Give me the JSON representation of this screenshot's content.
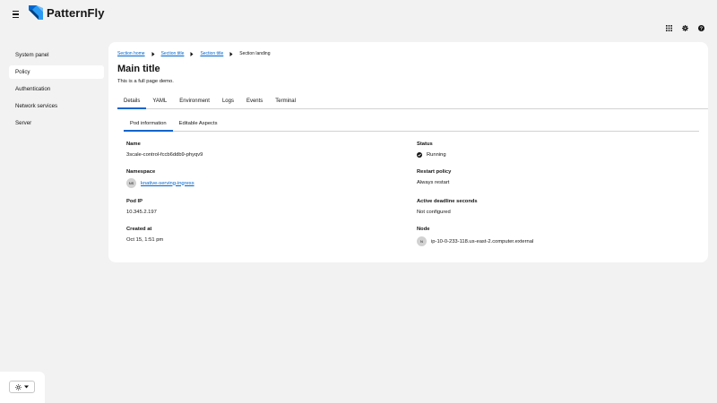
{
  "masthead": {
    "brand": "PatternFly",
    "icons": [
      "grid-icon",
      "gear-icon",
      "help-icon"
    ]
  },
  "sidebar": {
    "items": [
      {
        "label": "System panel"
      },
      {
        "label": "Policy"
      },
      {
        "label": "Authentication"
      },
      {
        "label": "Network services"
      },
      {
        "label": "Server"
      }
    ],
    "active": "Policy"
  },
  "breadcrumb": {
    "items": [
      "Section home",
      "Section title",
      "Section title"
    ],
    "current": "Section landing"
  },
  "page": {
    "title": "Main title",
    "subtitle": "This is a full page demo."
  },
  "tabs": [
    "Details",
    "YAML",
    "Environment",
    "Logs",
    "Events",
    "Terminal"
  ],
  "subtabs": [
    "Pod information",
    "Editable Aspects"
  ],
  "details": {
    "name_label": "Name",
    "name_value": "3scale-control-fccb6ddb9-phyqv9",
    "namespace_label": "Namespace",
    "namespace_badge": "NS",
    "namespace_value": "knative-serving-ingress",
    "pod_ip_label": "Pod IP",
    "pod_ip_value": "10.345.2.197",
    "created_label": "Created at",
    "created_value": "Oct 15, 1:51 pm",
    "status_label": "Status",
    "status_value": "Running",
    "restart_label": "Restart policy",
    "restart_value": "Always restart",
    "deadline_label": "Active deadline seconds",
    "deadline_value": "Not configured",
    "node_label": "Node",
    "node_badge": "N",
    "node_value": "ip-10-0-233-118.us-east-2.computer.external"
  },
  "colors": {
    "link": "#0066cc",
    "background": "#f2f2f2",
    "card": "#ffffff"
  }
}
